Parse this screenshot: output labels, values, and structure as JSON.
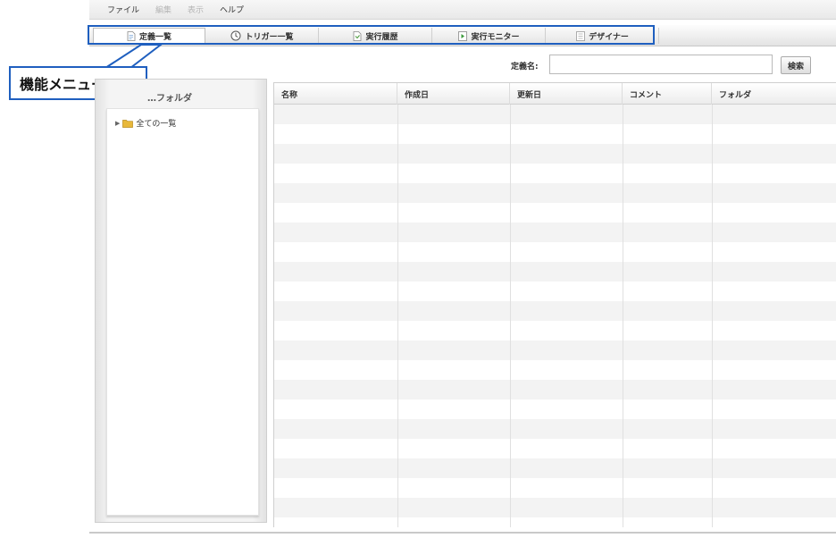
{
  "menubar": {
    "items": [
      {
        "label": "ファイル",
        "enabled": true
      },
      {
        "label": "編集",
        "enabled": false
      },
      {
        "label": "表示",
        "enabled": false
      },
      {
        "label": "ヘルプ",
        "enabled": true
      }
    ]
  },
  "tabs": [
    {
      "label": "定義一覧",
      "icon": "document-icon",
      "active": true
    },
    {
      "label": "トリガー一覧",
      "icon": "clock-icon",
      "active": false
    },
    {
      "label": "実行履歴",
      "icon": "history-icon",
      "active": false
    },
    {
      "label": "実行モニター",
      "icon": "play-icon",
      "active": false
    },
    {
      "label": "デザイナー",
      "icon": "designer-icon",
      "active": false
    }
  ],
  "callout": {
    "label": "機能メニュー",
    "return_mark": "↵"
  },
  "search": {
    "label": "定義名:",
    "value": "",
    "placeholder": "",
    "button_label": "検索"
  },
  "left_panel": {
    "header": "…フォルダ",
    "tree": [
      {
        "label": "全ての一覧",
        "icon": "folder-icon",
        "expanded": false
      }
    ]
  },
  "table": {
    "columns": [
      "名称",
      "作成日",
      "更新日",
      "コメント",
      "フォルダ"
    ],
    "rows": []
  },
  "colors": {
    "highlight": "#1f5fbf",
    "row_stripe": "#f3f3f3",
    "folder": "#e8b83a"
  }
}
